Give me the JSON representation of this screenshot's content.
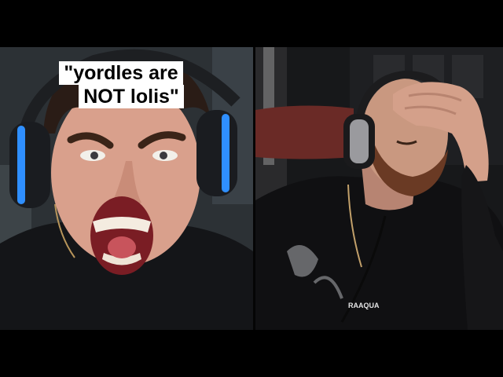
{
  "caption": {
    "line1": "\"yordles are",
    "line2": "NOT lolis\""
  },
  "shirt_text": "RAAQUA",
  "colors": {
    "letterbox": "#000000",
    "caption_bg": "#ffffff",
    "caption_text": "#000000",
    "headset_accent": "#2f8fff"
  }
}
